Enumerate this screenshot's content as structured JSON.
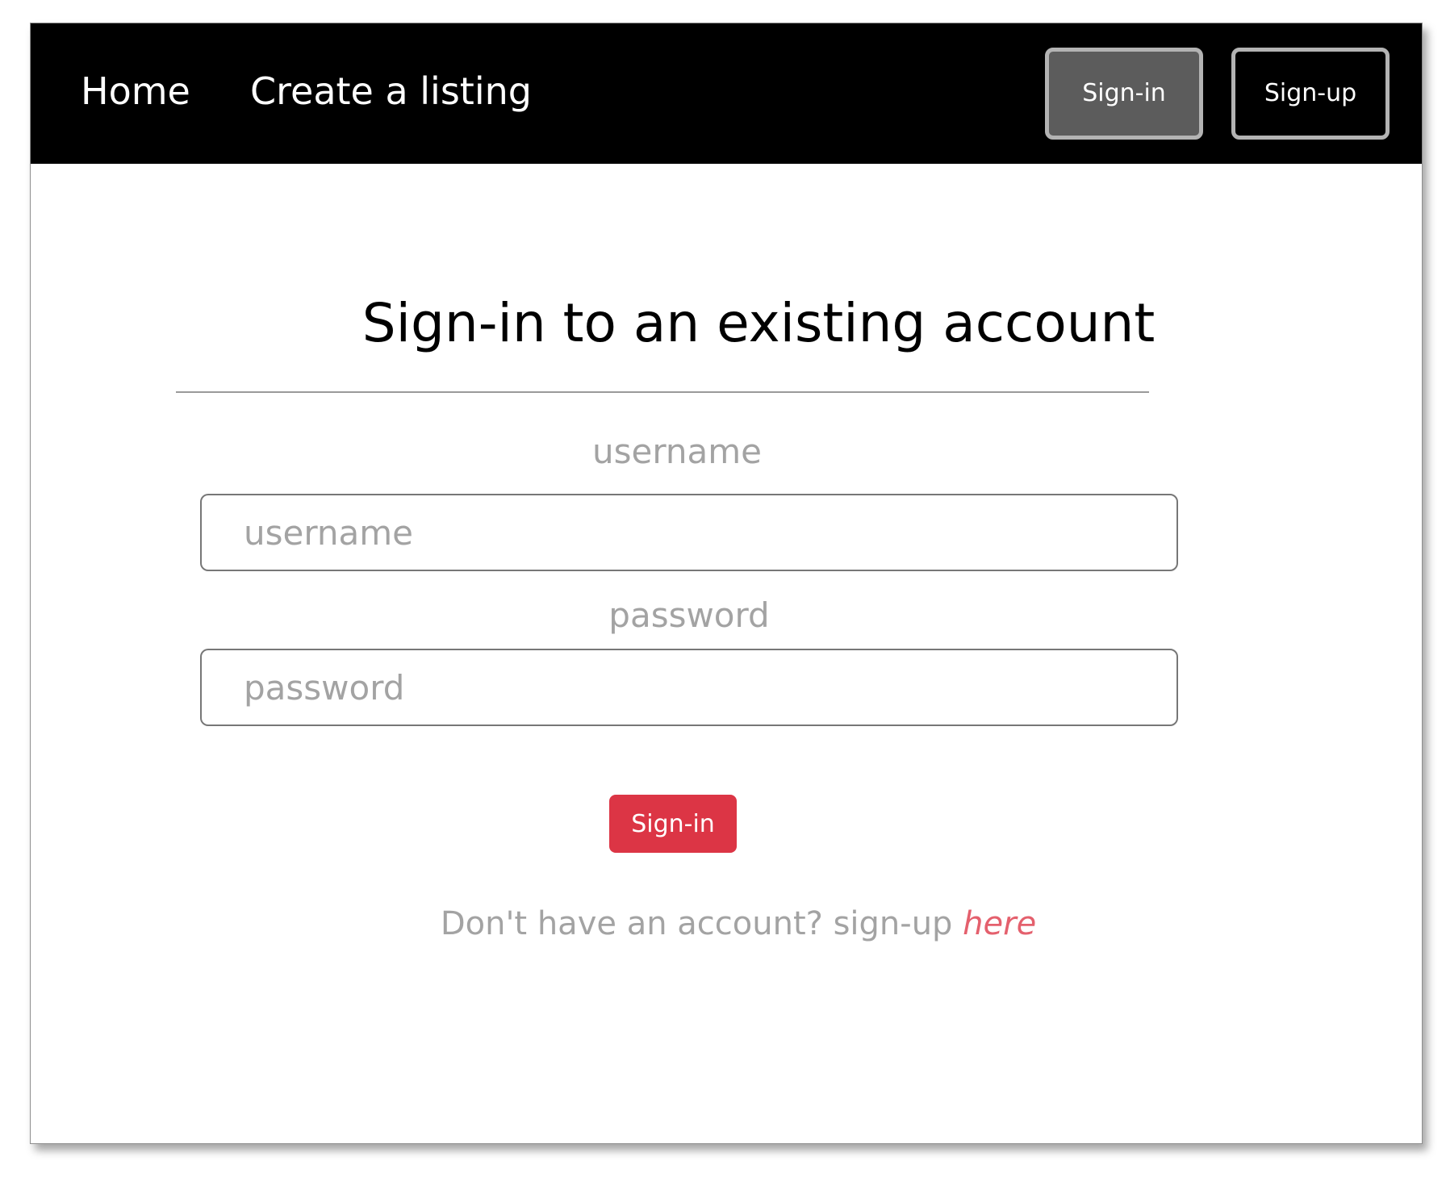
{
  "nav": {
    "home_label": "Home",
    "create_label": "Create a listing",
    "signin_label": "Sign-in",
    "signup_label": "Sign-up"
  },
  "form": {
    "title": "Sign-in to an existing account",
    "username_label": "username",
    "username_placeholder": "username",
    "username_value": "",
    "password_label": "password",
    "password_placeholder": "password",
    "password_value": "",
    "submit_label": "Sign-in",
    "footer_prefix": "Don't have an account? sign-up",
    "footer_link": "here"
  },
  "colors": {
    "navbar_bg": "#000000",
    "active_nav_button": "#5c5c5c",
    "submit_button": "#dc3545",
    "link": "#e4606d",
    "muted_text": "#a3a3a3"
  }
}
